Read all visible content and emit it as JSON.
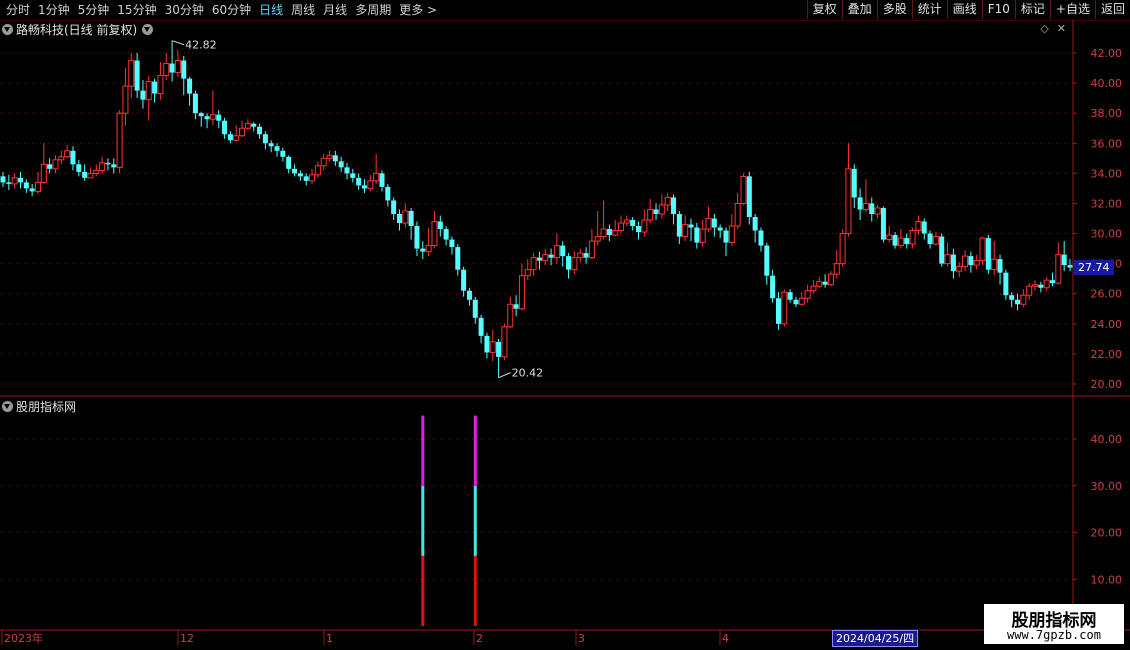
{
  "toolbar": {
    "periods": [
      "分时",
      "1分钟",
      "5分钟",
      "15分钟",
      "30分钟",
      "60分钟",
      "日线",
      "周线",
      "月线",
      "多周期",
      "更多 >"
    ],
    "active_period": "日线",
    "tools": [
      "复权",
      "叠加",
      "多股",
      "统计",
      "画线",
      "F10",
      "标记",
      "+自选",
      "返回"
    ]
  },
  "main_panel": {
    "title": "路畅科技(日线 前复权)",
    "current_price": "27.74",
    "y_ticks": [
      "42.00",
      "40.00",
      "38.00",
      "36.00",
      "34.00",
      "32.00",
      "30.00",
      "28.00",
      "26.00",
      "24.00",
      "22.00",
      "20.00"
    ],
    "high_label": "42.82",
    "low_label": "20.42"
  },
  "indicator_panel": {
    "title": "股朋指标网",
    "y_ticks": [
      "40.00",
      "30.00",
      "20.00",
      "10.00"
    ]
  },
  "x_axis": {
    "labels": [
      "2023年",
      "12",
      "1",
      "2",
      "3",
      "4"
    ],
    "selected_date": "2024/04/25/四"
  },
  "watermark": {
    "title": "股朋指标网",
    "url": "www.7gpzb.com"
  },
  "chart_data": {
    "type": "candlestick",
    "ylim": [
      19.5,
      43.2
    ],
    "candles": [
      [
        33.8,
        33.4,
        34.1,
        33.1
      ],
      [
        33.4,
        33.3,
        33.9,
        32.9
      ],
      [
        33.3,
        33.7,
        34.0,
        33.0
      ],
      [
        33.7,
        33.4,
        34.1,
        33.0
      ],
      [
        33.4,
        33.0,
        33.6,
        32.7
      ],
      [
        33.0,
        32.8,
        33.3,
        32.5
      ],
      [
        32.8,
        33.4,
        34.1,
        32.6
      ],
      [
        33.4,
        34.6,
        36.0,
        33.3
      ],
      [
        34.6,
        34.3,
        35.0,
        34.0
      ],
      [
        34.3,
        34.9,
        35.2,
        34.0
      ],
      [
        34.9,
        35.1,
        35.5,
        34.6
      ],
      [
        35.1,
        35.5,
        35.9,
        35.0
      ],
      [
        35.5,
        34.6,
        35.8,
        34.2
      ],
      [
        34.6,
        34.1,
        34.9,
        33.8
      ],
      [
        34.1,
        33.7,
        34.6,
        33.5
      ],
      [
        33.7,
        34.0,
        34.4,
        33.7
      ],
      [
        34.0,
        34.2,
        34.6,
        33.8
      ],
      [
        34.2,
        34.7,
        35.1,
        34.0
      ],
      [
        34.7,
        34.6,
        35.0,
        34.2
      ],
      [
        34.6,
        34.4,
        35.0,
        34.0
      ],
      [
        34.4,
        38.0,
        38.2,
        34.0
      ],
      [
        38.0,
        39.8,
        41.0,
        37.2
      ],
      [
        39.8,
        41.5,
        42.0,
        39.0
      ],
      [
        41.5,
        39.5,
        42.0,
        39.0
      ],
      [
        39.5,
        38.9,
        40.2,
        38.3
      ],
      [
        38.9,
        40.1,
        40.5,
        37.5
      ],
      [
        40.1,
        39.3,
        40.3,
        38.7
      ],
      [
        39.3,
        40.5,
        41.4,
        38.9
      ],
      [
        40.5,
        41.3,
        42.0,
        40.2
      ],
      [
        41.3,
        40.7,
        42.82,
        40.1
      ],
      [
        40.7,
        41.5,
        42.2,
        40.4
      ],
      [
        41.5,
        40.3,
        41.8,
        39.2
      ],
      [
        40.3,
        39.3,
        40.4,
        38.5
      ],
      [
        39.3,
        38.0,
        39.5,
        37.6
      ],
      [
        38.0,
        37.8,
        38.1,
        37.1
      ],
      [
        37.8,
        37.6,
        38.0,
        37.0
      ],
      [
        37.6,
        37.9,
        39.5,
        37.2
      ],
      [
        37.9,
        37.5,
        38.2,
        37.0
      ],
      [
        37.5,
        36.6,
        37.7,
        36.3
      ],
      [
        36.6,
        36.2,
        36.8,
        36.0
      ],
      [
        36.2,
        36.5,
        37.2,
        36.1
      ],
      [
        36.5,
        37.0,
        37.5,
        36.4
      ],
      [
        37.0,
        37.3,
        37.6,
        36.9
      ],
      [
        37.3,
        37.1,
        37.4,
        36.8
      ],
      [
        37.1,
        36.6,
        37.3,
        36.3
      ],
      [
        36.6,
        36.0,
        36.8,
        35.6
      ],
      [
        36.0,
        35.8,
        36.2,
        35.4
      ],
      [
        35.8,
        35.5,
        36.0,
        35.1
      ],
      [
        35.5,
        35.1,
        35.7,
        34.8
      ],
      [
        35.1,
        34.3,
        35.2,
        34.0
      ],
      [
        34.3,
        34.0,
        34.6,
        33.8
      ],
      [
        34.0,
        33.8,
        34.2,
        33.5
      ],
      [
        33.8,
        33.5,
        34.0,
        33.2
      ],
      [
        33.5,
        33.9,
        34.3,
        33.3
      ],
      [
        33.9,
        34.5,
        34.8,
        33.7
      ],
      [
        34.5,
        35.0,
        35.3,
        34.2
      ],
      [
        35.0,
        35.2,
        35.5,
        34.8
      ],
      [
        35.2,
        34.8,
        35.5,
        34.5
      ],
      [
        34.8,
        34.4,
        35.1,
        34.1
      ],
      [
        34.4,
        34.0,
        34.7,
        33.6
      ],
      [
        34.0,
        33.7,
        34.3,
        33.4
      ],
      [
        33.7,
        33.2,
        34.0,
        32.9
      ],
      [
        33.2,
        33.0,
        33.6,
        32.7
      ],
      [
        33.0,
        33.5,
        33.9,
        32.8
      ],
      [
        33.5,
        34.0,
        35.3,
        33.3
      ],
      [
        34.0,
        33.1,
        34.2,
        32.8
      ],
      [
        33.1,
        32.2,
        33.3,
        31.8
      ],
      [
        32.2,
        31.3,
        32.4,
        30.9
      ],
      [
        31.3,
        30.7,
        31.6,
        30.2
      ],
      [
        30.7,
        31.5,
        32.0,
        30.4
      ],
      [
        31.5,
        30.5,
        31.7,
        29.6
      ],
      [
        30.5,
        29.0,
        30.8,
        28.5
      ],
      [
        29.0,
        28.8,
        29.5,
        28.3
      ],
      [
        28.8,
        29.2,
        30.4,
        28.5
      ],
      [
        29.2,
        30.8,
        31.5,
        29.0
      ],
      [
        30.8,
        30.3,
        31.2,
        29.8
      ],
      [
        30.3,
        29.6,
        30.5,
        29.2
      ],
      [
        29.6,
        29.1,
        29.8,
        28.6
      ],
      [
        29.1,
        27.6,
        29.3,
        27.2
      ],
      [
        27.6,
        26.2,
        27.8,
        25.8
      ],
      [
        26.2,
        25.6,
        26.4,
        25.2
      ],
      [
        25.6,
        24.4,
        25.8,
        24.0
      ],
      [
        24.4,
        23.2,
        24.6,
        22.7
      ],
      [
        23.2,
        22.1,
        23.4,
        21.7
      ],
      [
        22.1,
        22.8,
        23.6,
        21.5
      ],
      [
        22.8,
        21.8,
        23.0,
        20.42
      ],
      [
        21.8,
        23.8,
        24.0,
        21.6
      ],
      [
        23.8,
        25.3,
        25.8,
        23.7
      ],
      [
        25.3,
        25.0,
        25.9,
        24.5
      ],
      [
        25.0,
        27.2,
        28.0,
        24.9
      ],
      [
        27.2,
        27.6,
        28.3,
        26.9
      ],
      [
        27.6,
        28.4,
        28.7,
        27.2
      ],
      [
        28.4,
        28.2,
        28.8,
        27.6
      ],
      [
        28.2,
        28.6,
        29.0,
        27.9
      ],
      [
        28.6,
        28.4,
        29.0,
        27.9
      ],
      [
        28.4,
        29.2,
        30.0,
        28.0
      ],
      [
        29.2,
        28.5,
        29.5,
        27.8
      ],
      [
        28.5,
        27.6,
        28.7,
        27.0
      ],
      [
        27.6,
        28.4,
        28.8,
        27.3
      ],
      [
        28.4,
        28.7,
        29.0,
        28.1
      ],
      [
        28.7,
        28.4,
        29.1,
        28.0
      ],
      [
        28.4,
        29.5,
        30.3,
        28.3
      ],
      [
        29.5,
        29.8,
        31.5,
        29.2
      ],
      [
        29.8,
        30.3,
        32.2,
        29.6
      ],
      [
        30.3,
        29.9,
        30.6,
        29.5
      ],
      [
        29.9,
        30.2,
        30.9,
        29.8
      ],
      [
        30.2,
        30.7,
        31.2,
        30.0
      ],
      [
        30.7,
        30.9,
        31.2,
        30.5
      ],
      [
        30.9,
        30.5,
        31.1,
        30.2
      ],
      [
        30.5,
        30.1,
        30.8,
        29.6
      ],
      [
        30.1,
        30.9,
        31.6,
        29.8
      ],
      [
        30.9,
        31.6,
        32.3,
        30.7
      ],
      [
        31.6,
        31.3,
        32.0,
        30.9
      ],
      [
        31.3,
        31.9,
        32.6,
        31.0
      ],
      [
        31.9,
        32.4,
        32.7,
        31.5
      ],
      [
        32.4,
        31.3,
        32.6,
        30.6
      ],
      [
        31.3,
        29.8,
        31.5,
        29.3
      ],
      [
        29.8,
        30.6,
        31.2,
        29.5
      ],
      [
        30.6,
        30.4,
        31.0,
        29.5
      ],
      [
        30.4,
        29.4,
        30.7,
        29.0
      ],
      [
        29.4,
        30.3,
        30.9,
        29.1
      ],
      [
        30.3,
        31.0,
        31.8,
        30.1
      ],
      [
        31.0,
        30.4,
        31.3,
        29.8
      ],
      [
        30.4,
        30.2,
        30.6,
        29.7
      ],
      [
        30.2,
        29.4,
        30.4,
        28.5
      ],
      [
        29.4,
        30.5,
        31.3,
        29.2
      ],
      [
        30.5,
        32.0,
        32.7,
        30.3
      ],
      [
        32.0,
        33.8,
        34.0,
        31.9
      ],
      [
        33.8,
        31.1,
        34.1,
        30.6
      ],
      [
        31.1,
        30.2,
        31.3,
        29.4
      ],
      [
        30.2,
        29.2,
        30.4,
        28.8
      ],
      [
        29.2,
        27.2,
        29.4,
        26.6
      ],
      [
        27.2,
        25.7,
        27.6,
        25.4
      ],
      [
        25.7,
        24.0,
        26.1,
        23.6
      ],
      [
        24.0,
        26.1,
        26.3,
        23.8
      ],
      [
        26.1,
        25.6,
        26.3,
        25.4
      ],
      [
        25.6,
        25.3,
        25.8,
        25.1
      ],
      [
        25.3,
        25.7,
        26.1,
        25.2
      ],
      [
        25.7,
        26.2,
        26.6,
        25.4
      ],
      [
        26.2,
        26.5,
        26.9,
        26.0
      ],
      [
        26.5,
        26.8,
        27.1,
        26.4
      ],
      [
        26.8,
        26.6,
        27.3,
        26.4
      ],
      [
        26.6,
        27.3,
        27.5,
        26.5
      ],
      [
        27.3,
        28.0,
        28.9,
        27.0
      ],
      [
        28.0,
        30.0,
        30.3,
        27.8
      ],
      [
        30.0,
        34.3,
        36.0,
        29.8
      ],
      [
        34.3,
        32.4,
        34.6,
        31.7
      ],
      [
        32.4,
        31.6,
        33.0,
        30.9
      ],
      [
        31.6,
        32.0,
        33.6,
        31.4
      ],
      [
        32.0,
        31.3,
        32.4,
        30.8
      ],
      [
        31.3,
        31.7,
        31.9,
        31.0
      ],
      [
        31.7,
        29.6,
        31.8,
        29.4
      ],
      [
        29.6,
        29.9,
        30.5,
        29.4
      ],
      [
        29.9,
        29.2,
        30.1,
        29.0
      ],
      [
        29.2,
        29.7,
        30.3,
        29.0
      ],
      [
        29.7,
        29.3,
        30.0,
        29.0
      ],
      [
        29.3,
        30.2,
        30.4,
        29.0
      ],
      [
        30.2,
        30.8,
        31.2,
        29.9
      ],
      [
        30.8,
        30.0,
        31.0,
        29.6
      ],
      [
        30.0,
        29.3,
        30.2,
        29.0
      ],
      [
        29.3,
        29.8,
        30.1,
        29.2
      ],
      [
        29.8,
        28.0,
        30.0,
        27.8
      ],
      [
        28.0,
        28.6,
        29.4,
        27.8
      ],
      [
        28.6,
        27.5,
        29.0,
        27.0
      ],
      [
        27.5,
        27.8,
        28.1,
        27.1
      ],
      [
        27.8,
        28.5,
        28.9,
        27.5
      ],
      [
        28.5,
        27.9,
        28.8,
        27.4
      ],
      [
        27.9,
        28.2,
        28.6,
        27.6
      ],
      [
        28.2,
        29.7,
        29.8,
        27.9
      ],
      [
        29.7,
        27.6,
        29.9,
        27.3
      ],
      [
        27.6,
        28.3,
        29.5,
        27.2
      ],
      [
        28.3,
        27.4,
        28.6,
        26.6
      ],
      [
        27.4,
        25.9,
        27.6,
        25.6
      ],
      [
        25.9,
        25.6,
        26.1,
        25.1
      ],
      [
        25.6,
        25.3,
        26.0,
        24.9
      ],
      [
        25.3,
        25.9,
        26.3,
        25.1
      ],
      [
        25.9,
        26.5,
        26.7,
        25.6
      ],
      [
        26.5,
        26.6,
        26.9,
        26.2
      ],
      [
        26.6,
        26.4,
        26.8,
        26.1
      ],
      [
        26.4,
        26.9,
        27.1,
        26.2
      ],
      [
        26.9,
        26.7,
        27.4,
        26.5
      ],
      [
        26.7,
        28.6,
        29.4,
        26.6
      ],
      [
        28.6,
        27.9,
        29.5,
        27.5
      ],
      [
        27.9,
        27.74,
        28.3,
        27.5
      ]
    ],
    "indicator_bars": [
      {
        "index": 72,
        "segments": [
          [
            0,
            15,
            "#e01010"
          ],
          [
            15,
            30,
            "#40e8e8"
          ],
          [
            30,
            45,
            "#e020e0"
          ]
        ]
      },
      {
        "index": 81,
        "segments": [
          [
            0,
            15,
            "#e01010"
          ],
          [
            15,
            30,
            "#40e8e8"
          ],
          [
            30,
            45,
            "#e020e0"
          ]
        ]
      }
    ],
    "indicator_ylim": [
      0,
      48
    ],
    "up_color": "#ff3232",
    "down_color": "#54ffff"
  }
}
